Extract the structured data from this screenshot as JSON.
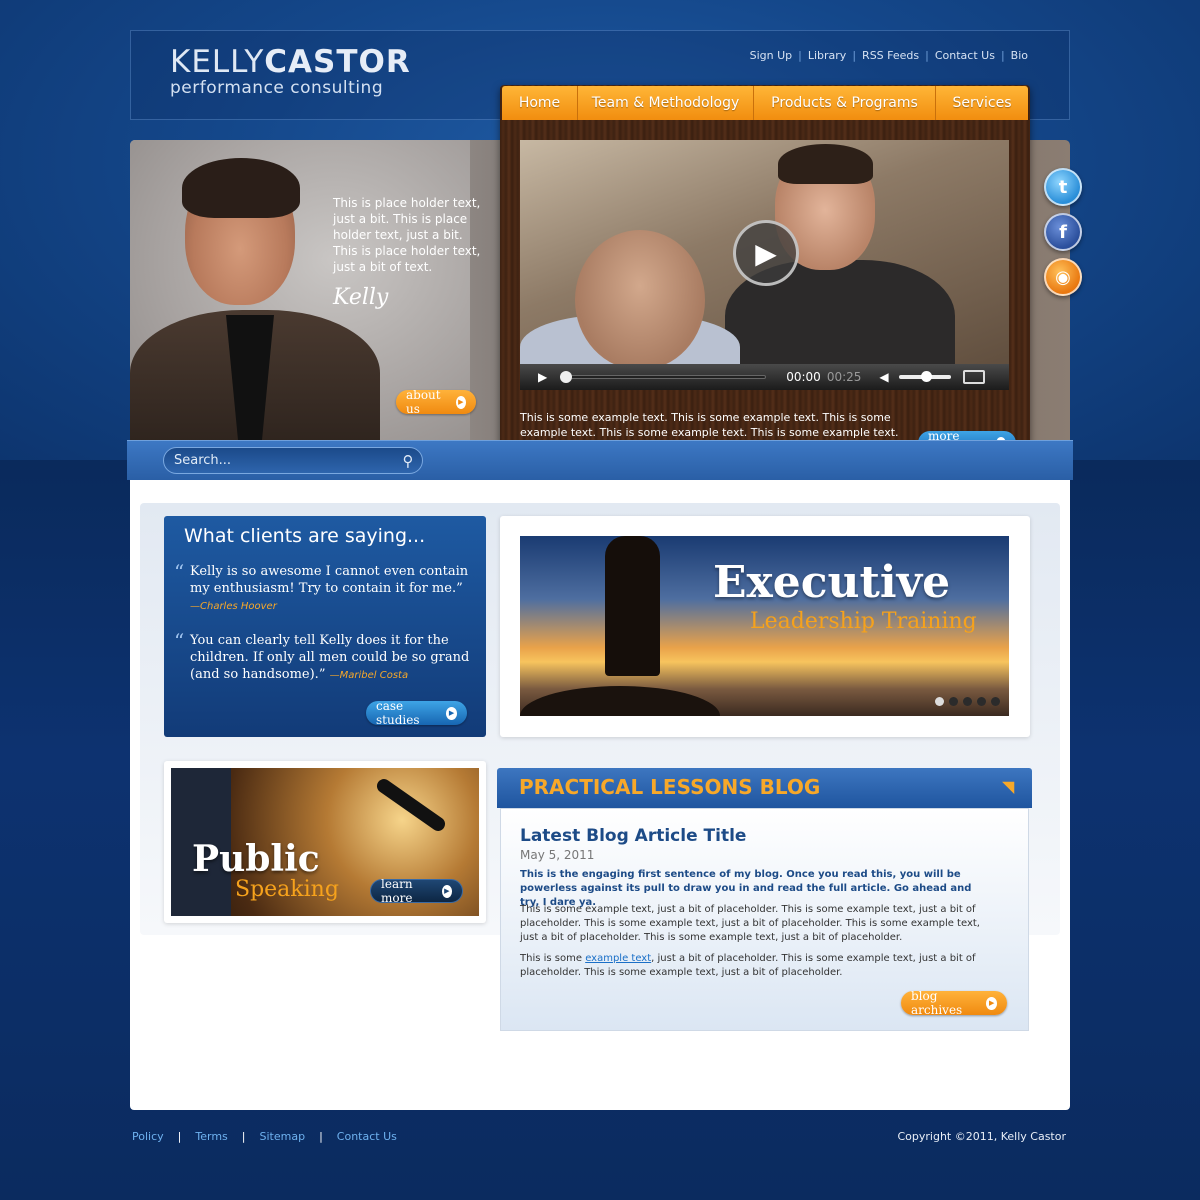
{
  "brand": {
    "name_first": "KELLY",
    "name_last": "CASTOR",
    "tagline": "performance consulting",
    "colors": {
      "navy": "#0d2f63",
      "orange": "#f18d0f",
      "blue": "#1f559f"
    }
  },
  "utility_nav": [
    "Sign Up",
    "Library",
    "RSS Feeds",
    "Contact Us",
    "Bio"
  ],
  "main_nav": [
    "Home",
    "Team & Methodology",
    "Products & Programs",
    "Services"
  ],
  "hero": {
    "text": "This is place holder text, just a bit. This is place holder text, just a bit. This is place holder text, just a bit of text.",
    "signature": "Kelly",
    "about_button": "about us"
  },
  "video": {
    "current_time": "00:00",
    "duration": "00:25",
    "caption": "This is some example text. This is some example text. This is some example text. This is some example text. This is some example text.",
    "more_button": "more videos"
  },
  "social": [
    "twitter-icon",
    "facebook-icon",
    "rss-icon"
  ],
  "search": {
    "placeholder": "Search..."
  },
  "testimonials": {
    "title": "What clients are saying...",
    "quotes": [
      {
        "text": "Kelly is so awesome I cannot even contain my enthusiasm! Try to contain it for me.”",
        "author": "—Charles Hoover"
      },
      {
        "text": "You can clearly tell Kelly does it for the children. If only all men could be so grand (and so handsome).”",
        "author": "—Maribel Costa"
      }
    ],
    "button": "case studies"
  },
  "banner": {
    "title": "Executive",
    "subtitle": "Leadership Training"
  },
  "public_speaking": {
    "title": "Public",
    "subtitle": "Speaking",
    "button": "learn more"
  },
  "blog": {
    "header": "PRACTICAL LESSONS BLOG",
    "title": "Latest Blog Article Title",
    "date": "May 5, 2011",
    "lead": "This is the engaging first sentence of my blog. Once you read this, you will be powerless against its pull to draw you in and read the full article. Go ahead and try, I dare ya.",
    "p1": "This is some example text, just a bit of placeholder. This is some example text, just a bit of placeholder. This is some example text, just a bit of placeholder. This is some example text, just a bit of placeholder. This is some example text, just a bit of placeholder.",
    "p2_before": "This is some ",
    "p2_link": "example text",
    "p2_after": ", just a bit of placeholder. This is some example text, just a bit of placeholder. This is some example text, just a bit of placeholder.",
    "button": "blog archives"
  },
  "footer": {
    "links": [
      "Policy",
      "Terms",
      "Sitemap",
      "Contact Us"
    ],
    "copyright": "Copyright ©2011, Kelly Castor"
  }
}
